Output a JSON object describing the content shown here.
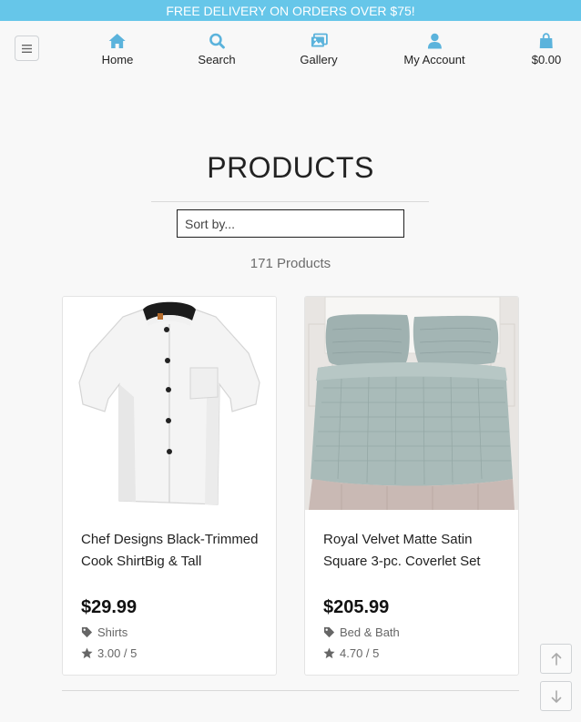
{
  "banner": {
    "text": "FREE DELIVERY ON ORDERS OVER $75!"
  },
  "colors": {
    "accent": "#66c6e9",
    "nav_icon": "#5bb3dc"
  },
  "nav": {
    "menu_icon": "hamburger-icon",
    "items": [
      {
        "label": "Home",
        "icon": "home-icon"
      },
      {
        "label": "Search",
        "icon": "search-icon"
      },
      {
        "label": "Gallery",
        "icon": "gallery-icon"
      },
      {
        "label": "My Account",
        "icon": "user-icon"
      },
      {
        "label": "$0.00",
        "icon": "bag-icon"
      }
    ]
  },
  "page": {
    "title": "PRODUCTS",
    "sort_placeholder": "Sort by...",
    "count": "171 Products"
  },
  "products": [
    {
      "name": "Chef Designs Black-Trimmed Cook ShirtBig & Tall",
      "price": "$29.99",
      "category": "Shirts",
      "rating": "3.00 / 5",
      "image": "white-chef-shirt"
    },
    {
      "name": "Royal Velvet Matte Satin Square 3-pc. Coverlet Set",
      "price": "$205.99",
      "category": "Bed & Bath",
      "rating": "4.70 / 5",
      "image": "sage-coverlet-bed"
    }
  ],
  "scroll": {
    "up_icon": "arrow-up-icon",
    "down_icon": "arrow-down-icon"
  }
}
